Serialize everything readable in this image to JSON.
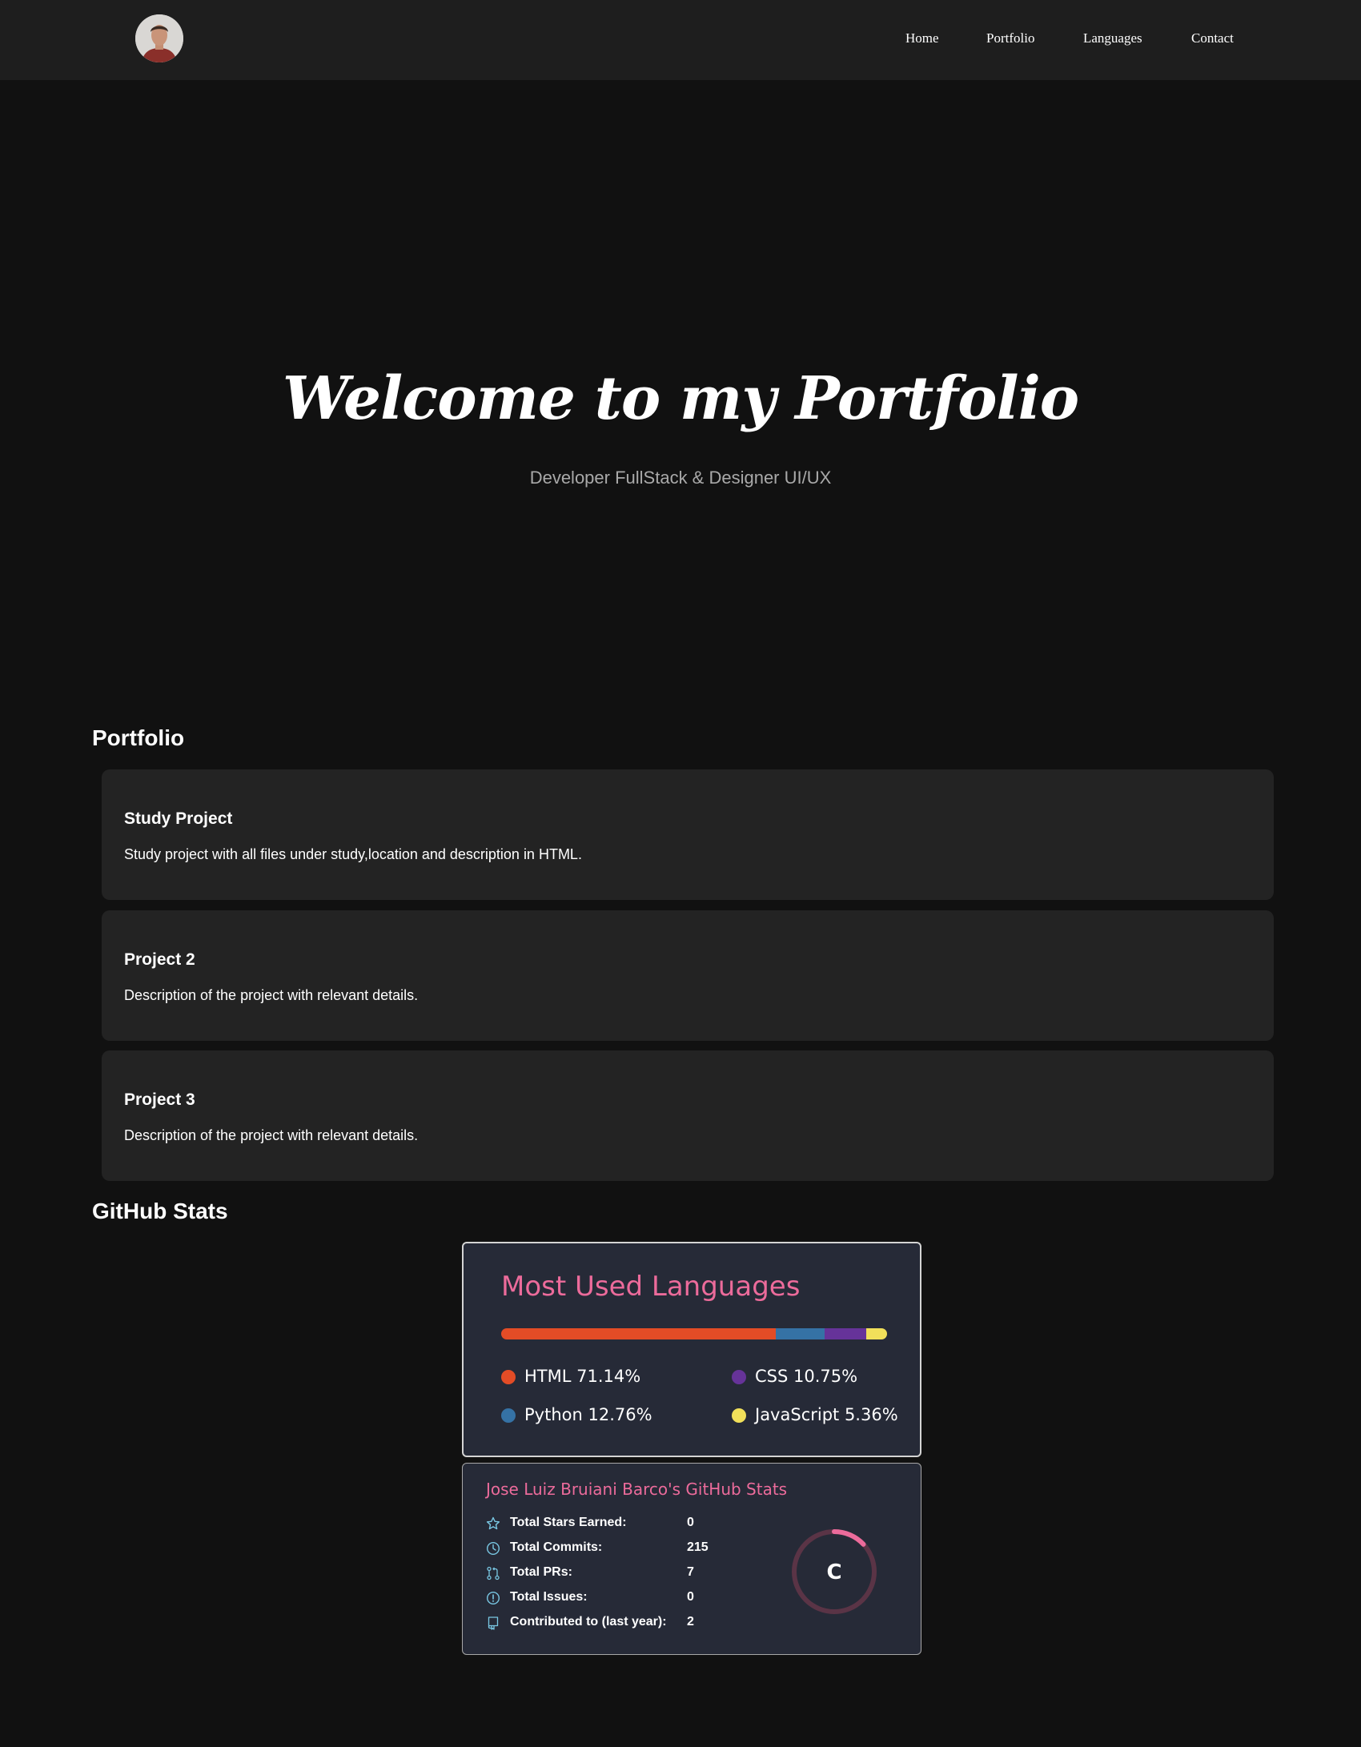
{
  "nav": {
    "items": [
      "Home",
      "Portfolio",
      "Languages",
      "Contact"
    ]
  },
  "hero": {
    "title": "Welcome to my Portfolio",
    "subtitle": "Developer FullStack & Designer UI/UX"
  },
  "portfolio": {
    "heading": "Portfolio",
    "projects": [
      {
        "title": "Study Project",
        "description": "Study project with all files under study,location and description in HTML."
      },
      {
        "title": "Project 2",
        "description": "Description of the project with relevant details."
      },
      {
        "title": "Project 3",
        "description": "Description of the project with relevant details."
      }
    ]
  },
  "github": {
    "heading": "GitHub Stats",
    "languages_card": {
      "title": "Most Used Languages",
      "languages": [
        {
          "label": "HTML 71.14%",
          "percent": 71.14,
          "color": "#e34c26"
        },
        {
          "label": "Python 12.76%",
          "percent": 12.76,
          "color": "#3572a5"
        },
        {
          "label": "CSS 10.75%",
          "percent": 10.75,
          "color": "#663399"
        },
        {
          "label": "JavaScript 5.36%",
          "percent": 5.36,
          "color": "#f1e05a"
        }
      ]
    },
    "stats_card": {
      "title": "Jose Luiz Bruiani Barco's GitHub Stats",
      "rows": [
        {
          "icon": "star-icon",
          "label": "Total Stars Earned:",
          "value": "0"
        },
        {
          "icon": "clock-icon",
          "label": "Total Commits:",
          "value": "215"
        },
        {
          "icon": "pull-request-icon",
          "label": "Total PRs:",
          "value": "7"
        },
        {
          "icon": "issue-icon",
          "label": "Total Issues:",
          "value": "0"
        },
        {
          "icon": "repo-icon",
          "label": "Contributed to (last year):",
          "value": "2"
        }
      ],
      "rank": "C",
      "rank_progress": 0.13
    }
  },
  "colors": {
    "background": "#111111",
    "navbar": "#1e1e1e",
    "card": "#232323",
    "stats_card": "#262a37",
    "accent_pink": "#ec6b9b",
    "icon_blue": "#79c7e3"
  }
}
